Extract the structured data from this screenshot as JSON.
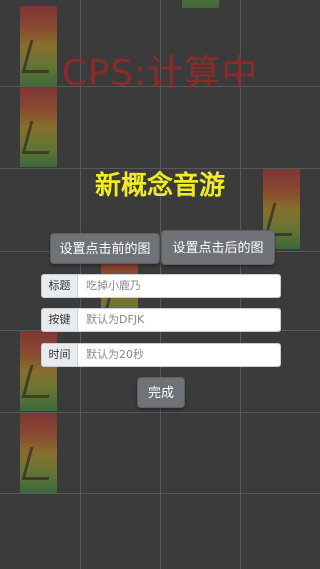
{
  "cps_text": "CPS:计算中",
  "game_title": "新概念音游",
  "buttons": {
    "set_before": "设置点击前的图",
    "set_after": "设置点击后的图",
    "done": "完成"
  },
  "fields": {
    "title": {
      "label": "标题",
      "placeholder": "吃掉小鹿乃"
    },
    "keys": {
      "label": "按键",
      "placeholder": "默认为DFJK"
    },
    "time": {
      "label": "时间",
      "placeholder": "默认为20秒"
    }
  },
  "colors": {
    "background": "#3b3b3b",
    "title": "#f2ea28",
    "cps": "#8e2a2a",
    "button": "#6f7378"
  }
}
